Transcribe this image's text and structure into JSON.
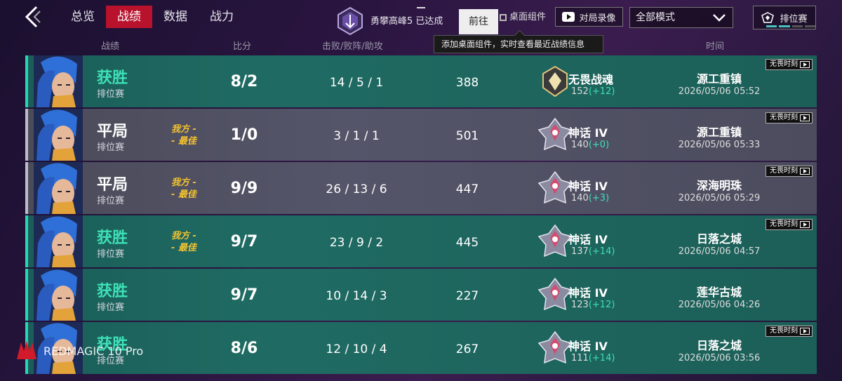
{
  "nav": {
    "tabs": [
      {
        "label": "总览",
        "active": false
      },
      {
        "label": "战绩",
        "active": true
      },
      {
        "label": "数据",
        "active": false
      },
      {
        "label": "战力",
        "active": false
      }
    ]
  },
  "achievement": {
    "text": "勇攀高峰5 已达成",
    "goto_label": "前往"
  },
  "widget": {
    "label": "桌面组件",
    "tooltip": "添加桌面组件，实时查看最近战绩信息"
  },
  "replay": {
    "label": "对局录像"
  },
  "mode_filter": {
    "selected": "全部模式"
  },
  "rank_button": {
    "label": "排位赛"
  },
  "headers": {
    "record": "战绩",
    "score": "比分",
    "kda": "击败/败阵/助攻",
    "time": "时间"
  },
  "colors": {
    "win": "#3ee0b6",
    "accent": "#b8122c",
    "mvp": "#f2c230"
  },
  "matches": [
    {
      "result": "获胜",
      "type": "win",
      "mode": "排位赛",
      "mvp": "",
      "score": "8/2",
      "kda": "14 / 5 / 1",
      "points": "388",
      "rank": "无畏战魂",
      "rank_pts": "152",
      "rank_delta": "(+12)",
      "map": "源工重镇",
      "datetime": "2026/05/06 05:52",
      "tag": "无畏时刻",
      "rank_icon": "silver-rank-icon"
    },
    {
      "result": "平局",
      "type": "draw",
      "mode": "排位赛",
      "mvp": "我方 -\n- 最佳",
      "score": "1/0",
      "kda": "3 / 1 / 1",
      "points": "501",
      "rank": "神话 IV",
      "rank_pts": "140",
      "rank_delta": "(+0)",
      "map": "源工重镇",
      "datetime": "2026/05/06 05:33",
      "tag": "无畏时刻",
      "rank_icon": "mythic-rank-icon"
    },
    {
      "result": "平局",
      "type": "draw",
      "mode": "排位赛",
      "mvp": "我方 -\n- 最佳",
      "score": "9/9",
      "kda": "26 / 13 / 6",
      "points": "447",
      "rank": "神话 IV",
      "rank_pts": "140",
      "rank_delta": "(+3)",
      "map": "深海明珠",
      "datetime": "2026/05/06 05:29",
      "tag": "无畏时刻",
      "rank_icon": "mythic-rank-icon"
    },
    {
      "result": "获胜",
      "type": "win",
      "mode": "排位赛",
      "mvp": "我方 -\n- 最佳",
      "score": "9/7",
      "kda": "23 / 9 / 2",
      "points": "445",
      "rank": "神话 IV",
      "rank_pts": "137",
      "rank_delta": "(+14)",
      "map": "日落之城",
      "datetime": "2026/05/06 04:57",
      "tag": "无畏时刻",
      "rank_icon": "mythic-rank-icon"
    },
    {
      "result": "获胜",
      "type": "win",
      "mode": "排位赛",
      "mvp": "",
      "score": "9/7",
      "kda": "10 / 14 / 3",
      "points": "227",
      "rank": "神话 IV",
      "rank_pts": "123",
      "rank_delta": "(+12)",
      "map": "莲华古城",
      "datetime": "2026/05/06 04:26",
      "tag": "",
      "rank_icon": "mythic-rank-icon"
    },
    {
      "result": "获胜",
      "type": "win",
      "mode": "排位赛",
      "mvp": "",
      "score": "8/6",
      "kda": "12 / 10 / 4",
      "points": "267",
      "rank": "神话 IV",
      "rank_pts": "111",
      "rank_delta": "(+14)",
      "map": "日落之城",
      "datetime": "2026/05/06 03:56",
      "tag": "无畏时刻",
      "rank_icon": "mythic-rank-icon"
    }
  ],
  "watermark": {
    "text": "REDMAGIC 10 Pro"
  }
}
